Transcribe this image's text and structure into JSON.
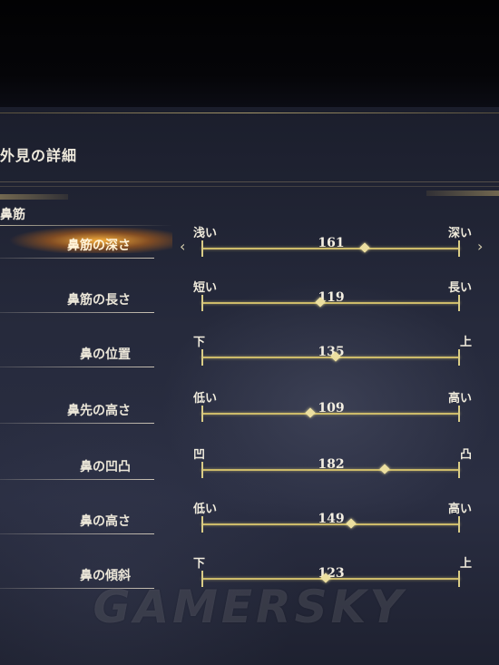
{
  "panel": {
    "title": "外見の詳細",
    "section": "鼻筋"
  },
  "sliders": [
    {
      "label": "鼻筋の深さ",
      "min_label": "浅い",
      "max_label": "深い",
      "value": "161",
      "selected": true,
      "position": 0.63
    },
    {
      "label": "鼻筋の長さ",
      "min_label": "短い",
      "max_label": "長い",
      "value": "119",
      "selected": false,
      "position": 0.46
    },
    {
      "label": "鼻の位置",
      "min_label": "下",
      "max_label": "上",
      "value": "135",
      "selected": false,
      "position": 0.52
    },
    {
      "label": "鼻先の高さ",
      "min_label": "低い",
      "max_label": "高い",
      "value": "109",
      "selected": false,
      "position": 0.42
    },
    {
      "label": "鼻の凹凸",
      "min_label": "凹",
      "max_label": "凸",
      "value": "182",
      "selected": false,
      "position": 0.71
    },
    {
      "label": "鼻の高さ",
      "min_label": "低い",
      "max_label": "高い",
      "value": "149",
      "selected": false,
      "position": 0.58
    },
    {
      "label": "鼻の傾斜",
      "min_label": "下",
      "max_label": "上",
      "value": "123",
      "selected": false,
      "position": 0.48
    }
  ],
  "arrows": {
    "left": "‹",
    "right": "›"
  },
  "watermark": "GAMERSKY",
  "colors": {
    "track": "#cdbb6a",
    "highlight": "#f0a030"
  }
}
